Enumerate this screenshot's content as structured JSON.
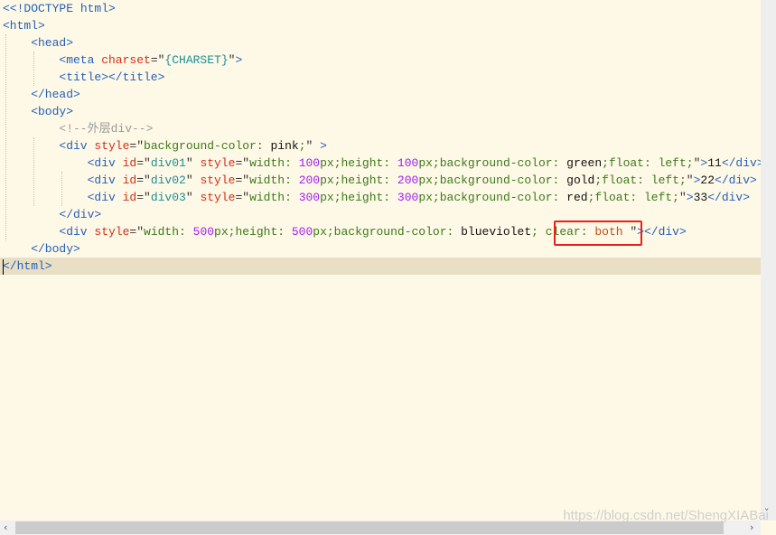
{
  "editor": {
    "highlighted_line": 16,
    "lines": [
      {
        "indent": 0,
        "tokens": [
          [
            "t",
            "<<!DOCTYPE html>"
          ]
        ]
      },
      {
        "indent": 0,
        "tokens": [
          [
            "t",
            "<html>"
          ]
        ]
      },
      {
        "indent": 1,
        "tokens": [
          [
            "t",
            "<head>"
          ]
        ]
      },
      {
        "indent": 2,
        "tokens": [
          [
            "t",
            "<meta "
          ],
          [
            "a",
            "charset"
          ],
          [
            "o",
            "=\""
          ],
          [
            "s",
            "{CHARSET}"
          ],
          [
            "o",
            "\""
          ],
          [
            "t",
            ">"
          ]
        ]
      },
      {
        "indent": 2,
        "tokens": [
          [
            "t",
            "<title></title>"
          ]
        ]
      },
      {
        "indent": 1,
        "tokens": [
          [
            "t",
            "</head>"
          ]
        ]
      },
      {
        "indent": 1,
        "tokens": [
          [
            "t",
            "<body>"
          ]
        ]
      },
      {
        "indent": 2,
        "tokens": [
          [
            "c",
            "<!--外层div-->"
          ]
        ]
      },
      {
        "indent": 2,
        "tokens": [
          [
            "t",
            "<div "
          ],
          [
            "a",
            "style"
          ],
          [
            "o",
            "=\""
          ],
          [
            "p",
            "background-color: "
          ],
          [
            "v",
            "pink"
          ],
          [
            "p",
            ";"
          ],
          [
            "o",
            "\" "
          ],
          [
            "t",
            ">"
          ]
        ]
      },
      {
        "indent": 3,
        "tokens": [
          [
            "t",
            "<div "
          ],
          [
            "a",
            "id"
          ],
          [
            "o",
            "=\""
          ],
          [
            "s",
            "div01"
          ],
          [
            "o",
            "\" "
          ],
          [
            "a",
            "style"
          ],
          [
            "o",
            "=\""
          ],
          [
            "p",
            "width: "
          ],
          [
            "n",
            "100"
          ],
          [
            "p",
            "px;height: "
          ],
          [
            "n",
            "100"
          ],
          [
            "p",
            "px;background-color: "
          ],
          [
            "v",
            "green"
          ],
          [
            "p",
            ";float: left;"
          ],
          [
            "o",
            "\""
          ],
          [
            "t",
            ">"
          ],
          [
            "v",
            "11"
          ],
          [
            "t",
            "</div>"
          ]
        ]
      },
      {
        "indent": 3,
        "tokens": [
          [
            "t",
            "<div "
          ],
          [
            "a",
            "id"
          ],
          [
            "o",
            "=\""
          ],
          [
            "s",
            "div02"
          ],
          [
            "o",
            "\" "
          ],
          [
            "a",
            "style"
          ],
          [
            "o",
            "=\""
          ],
          [
            "p",
            "width: "
          ],
          [
            "n",
            "200"
          ],
          [
            "p",
            "px;height: "
          ],
          [
            "n",
            "200"
          ],
          [
            "p",
            "px;background-color: "
          ],
          [
            "v",
            "gold"
          ],
          [
            "p",
            ";float: left;"
          ],
          [
            "o",
            "\""
          ],
          [
            "t",
            ">"
          ],
          [
            "v",
            "22"
          ],
          [
            "t",
            "</div>"
          ]
        ]
      },
      {
        "indent": 3,
        "tokens": [
          [
            "t",
            "<div "
          ],
          [
            "a",
            "id"
          ],
          [
            "o",
            "=\""
          ],
          [
            "s",
            "div03"
          ],
          [
            "o",
            "\" "
          ],
          [
            "a",
            "style"
          ],
          [
            "o",
            "=\""
          ],
          [
            "p",
            "width: "
          ],
          [
            "n",
            "300"
          ],
          [
            "p",
            "px;height: "
          ],
          [
            "n",
            "300"
          ],
          [
            "p",
            "px;background-color: "
          ],
          [
            "v",
            "red"
          ],
          [
            "p",
            ";float: left;"
          ],
          [
            "o",
            "\""
          ],
          [
            "t",
            ">"
          ],
          [
            "v",
            "33"
          ],
          [
            "t",
            "</div>"
          ]
        ]
      },
      {
        "indent": 2,
        "tokens": [
          [
            "t",
            "</div>"
          ]
        ]
      },
      {
        "indent": 2,
        "tokens": [
          [
            "t",
            "<div "
          ],
          [
            "a",
            "style"
          ],
          [
            "o",
            "=\""
          ],
          [
            "p",
            "width: "
          ],
          [
            "n",
            "500"
          ],
          [
            "p",
            "px;height: "
          ],
          [
            "n",
            "500"
          ],
          [
            "p",
            "px;background-color: "
          ],
          [
            "v",
            "blueviolet"
          ],
          [
            "p",
            "; clear: "
          ],
          [
            "k",
            "both"
          ],
          [
            "o",
            " \""
          ],
          [
            "t",
            "></div>"
          ]
        ]
      },
      {
        "indent": 1,
        "tokens": [
          [
            "t",
            "</body>"
          ]
        ]
      },
      {
        "indent": 0,
        "tokens": [
          [
            "t",
            "</html>"
          ]
        ]
      }
    ]
  },
  "colors": {
    "background": "#fef8e6",
    "highlight": "#e8dfc4",
    "annotation_box": "#e8201a"
  },
  "scrollbar": {
    "left_icon": "chevron-left-icon",
    "right_icon": "chevron-right-icon",
    "left": "‹",
    "right": "›",
    "down": "˅"
  },
  "watermark": "https://blog.csdn.net/ShengXIABai"
}
